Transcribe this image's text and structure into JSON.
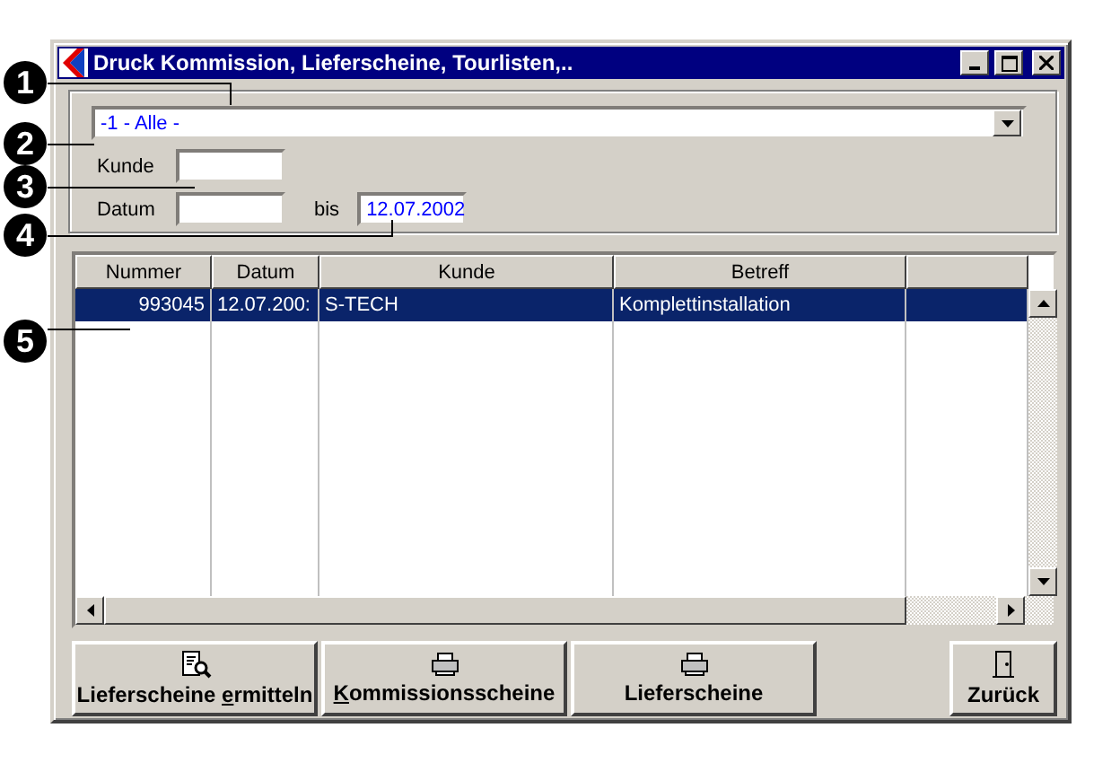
{
  "window": {
    "title": "Druck Kommission, Lieferscheine, Tourlisten,.."
  },
  "filter": {
    "combo_value": "-1 - Alle -",
    "kunde_label": "Kunde",
    "datum_label": "Datum",
    "bis_label": "bis",
    "bis_value": "12.07.2002"
  },
  "table": {
    "columns": [
      "Nummer",
      "Datum",
      "Kunde",
      "Betreff"
    ],
    "rows": [
      {
        "cells": [
          "993045",
          "12.07.200:",
          "S-TECH",
          "Komplettinstallation"
        ],
        "selected": true
      }
    ]
  },
  "buttons": [
    {
      "kind": "search",
      "before": "Lieferscheine ",
      "key": "e",
      "after": "rmitteln"
    },
    {
      "kind": "print",
      "key": "K",
      "after": "ommissionsscheine"
    },
    {
      "kind": "print",
      "before": "Lieferscheine"
    },
    {
      "kind": "exit",
      "before": "Zurück"
    }
  ],
  "callouts": [
    "1",
    "2",
    "3",
    "4",
    "5"
  ]
}
